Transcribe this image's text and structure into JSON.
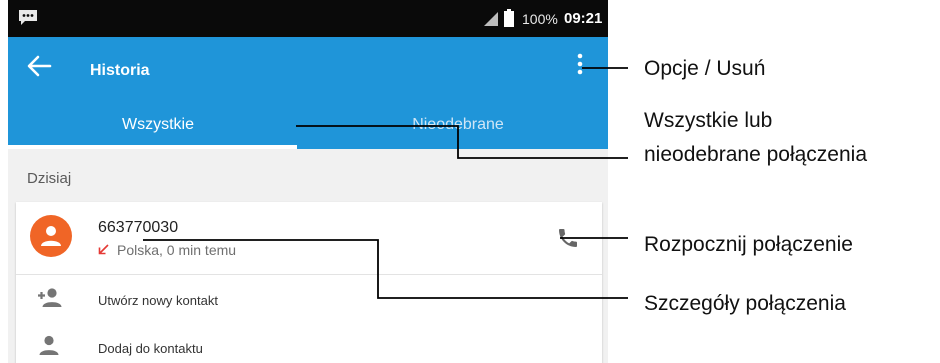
{
  "status_bar": {
    "battery": "100%",
    "time": "09:21",
    "icons": [
      "message-icon",
      "signal-icon",
      "battery-icon"
    ]
  },
  "app_bar": {
    "title": "Historia",
    "icons": [
      "back-arrow-icon",
      "overflow-menu-icon"
    ]
  },
  "tabs": [
    {
      "label": "Wszystkie",
      "selected": true
    },
    {
      "label": "Nieodebrane",
      "selected": false
    }
  ],
  "section": {
    "header": "Dzisiaj"
  },
  "call_entry": {
    "number": "663770030",
    "detail": "Polska, 0 min temu",
    "type_icon": "missed-call-arrow-icon",
    "call_action_icon": "phone-icon"
  },
  "actions": [
    {
      "label": "Utwórz nowy kontakt",
      "icon": "add-person-icon"
    },
    {
      "label": "Dodaj do kontaktu",
      "icon": "person-icon"
    }
  ],
  "callouts": [
    {
      "text": "Opcje / Usuń"
    },
    {
      "text": "Wszystkie lub nieodebrane połączenia"
    },
    {
      "text": "Rozpocznij połączenie"
    },
    {
      "text": "Szczegóły połączenia"
    }
  ],
  "colors": {
    "app_bar": "#1f95d9",
    "status_bar": "#0a0a0a",
    "avatar": "#f06526",
    "missed_arrow": "#e53935",
    "background": "#f1f1f1"
  }
}
